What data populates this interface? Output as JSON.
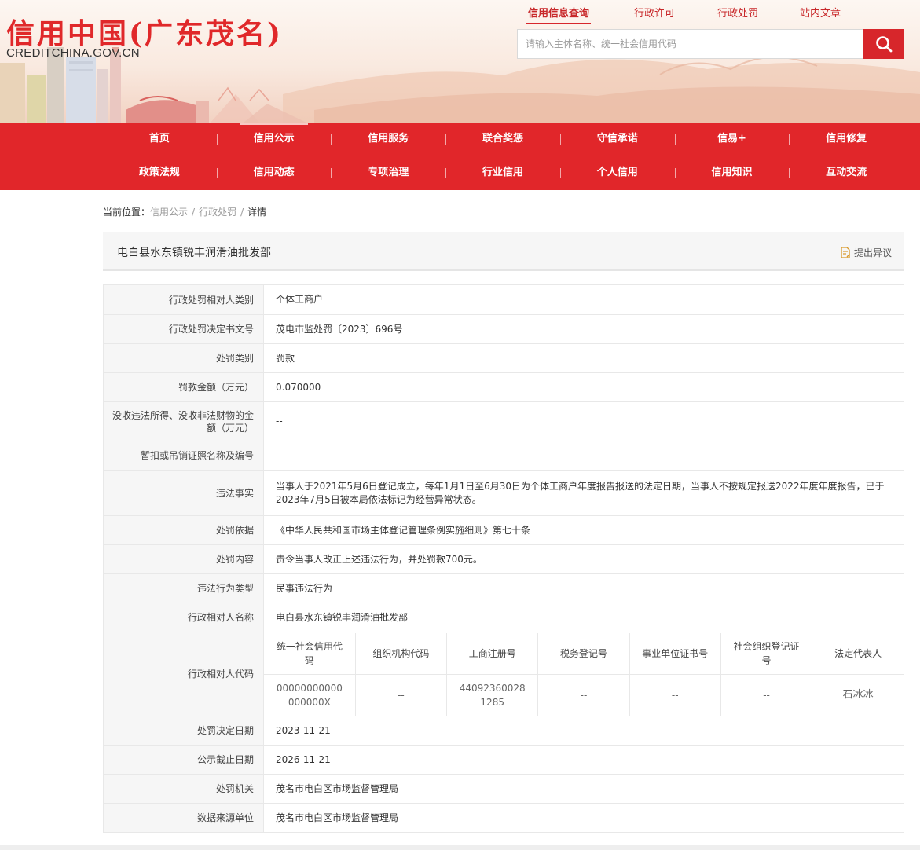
{
  "brand": {
    "logo_cn": "信用中国(广东茂名)",
    "logo_en": "CREDITCHINA.GOV.CN"
  },
  "top_links": [
    {
      "label": "信用信息查询",
      "active": true
    },
    {
      "label": "行政许可",
      "active": false
    },
    {
      "label": "行政处罚",
      "active": false
    },
    {
      "label": "站内文章",
      "active": false
    }
  ],
  "search": {
    "placeholder": "请输入主体名称、统一社会信用代码",
    "icon": "search-icon"
  },
  "nav": {
    "row1": [
      "首页",
      "信用公示",
      "信用服务",
      "联合奖惩",
      "守信承诺",
      "信易+",
      "信用修复"
    ],
    "row2": [
      "政策法规",
      "信用动态",
      "专项治理",
      "行业信用",
      "个人信用",
      "信用知识",
      "互动交流"
    ],
    "active": "信用公示"
  },
  "breadcrumb": {
    "prefix": "当前位置：",
    "items": [
      "信用公示",
      "行政处罚",
      "详情"
    ],
    "separator": "/"
  },
  "page_title": "电白县水东镇锐丰润滑油批发部",
  "objection_label": "提出异议",
  "details": {
    "r0": {
      "label": "行政处罚相对人类别",
      "value": "个体工商户"
    },
    "r1": {
      "label": "行政处罚决定书文号",
      "value": "茂电市监处罚〔2023〕696号"
    },
    "r2": {
      "label": "处罚类别",
      "value": "罚款"
    },
    "r3": {
      "label": "罚款金额（万元）",
      "value": "0.070000"
    },
    "r4": {
      "label": "没收违法所得、没收非法财物的金额（万元）",
      "value": "--"
    },
    "r5": {
      "label": "暂扣或吊销证照名称及编号",
      "value": "--"
    },
    "r6": {
      "label": "违法事实",
      "value": "当事人于2021年5月6日登记成立，每年1月1日至6月30日为个体工商户年度报告报送的法定日期，当事人不按规定报送2022年度年度报告，已于2023年7月5日被本局依法标记为经营异常状态。"
    },
    "r7": {
      "label": "处罚依据",
      "value": "《中华人民共和国市场主体登记管理条例实施细则》第七十条"
    },
    "r8": {
      "label": "处罚内容",
      "value": "责令当事人改正上述违法行为，并处罚款700元。"
    },
    "r9": {
      "label": "违法行为类型",
      "value": "民事违法行为"
    },
    "r10": {
      "label": "行政相对人名称",
      "value": "电白县水东镇锐丰润滑油批发部"
    },
    "codes": {
      "label": "行政相对人代码",
      "headers": [
        "统一社会信用代码",
        "组织机构代码",
        "工商注册号",
        "税务登记号",
        "事业单位证书号",
        "社会组织登记证号",
        "法定代表人"
      ],
      "values": [
        "00000000000000000X",
        "--",
        "440923600281285",
        "--",
        "--",
        "--",
        "石冰冰"
      ]
    },
    "r12": {
      "label": "处罚决定日期",
      "value": "2023-11-21"
    },
    "r13": {
      "label": "公示截止日期",
      "value": "2026-11-21"
    },
    "r14": {
      "label": "处罚机关",
      "value": "茂名市电白区市场监督管理局"
    },
    "r15": {
      "label": "数据来源单位",
      "value": "茂名市电白区市场监督管理局"
    }
  },
  "colors": {
    "brand_red": "#d7262b",
    "nav_red": "#e1262a",
    "label_bg": "#f6f6f6"
  }
}
